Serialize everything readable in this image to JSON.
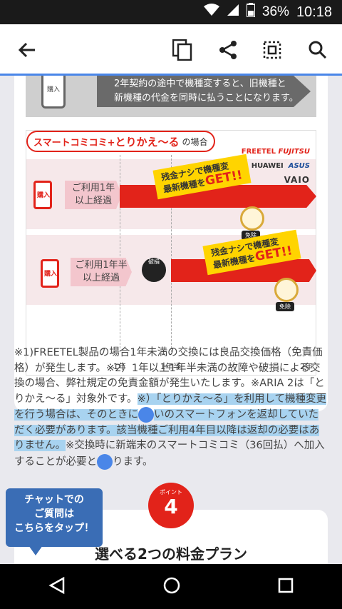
{
  "status_bar": {
    "battery": "36%",
    "time": "10:18"
  },
  "toolbar": {
    "back": "back",
    "copy": "copy",
    "share": "share",
    "select_all": "select-all",
    "search": "search"
  },
  "old_contract": {
    "phone_label": "購入",
    "text_line1": "2年契約の途中で機種変すると、旧機種と",
    "text_line2": "新機種の代金を同時に払うことになります。"
  },
  "diagram": {
    "title_a": "スマートコミコミ+",
    "title_b": "とりかえ〜る",
    "title_suffix": "の場合",
    "brands": [
      "FREETEL",
      "FUJITSU",
      "HUAWEI",
      "ASUS",
      "VAIO"
    ],
    "row1": {
      "phone_label": "購入",
      "text_line1": "ご利用1年",
      "text_line2": "以上経過",
      "tag_line1": "残金ナシで機種変",
      "tag_line2": "最新機種を",
      "tag_get": "GET!!",
      "exempt": "免除"
    },
    "row2": {
      "phone_label": "購入",
      "text_line1": "ご利用1年半",
      "text_line2": "以上経過",
      "tag_line1": "残金ナシで機種変",
      "tag_line2": "最新機種を",
      "tag_get": "GET!!",
      "exempt": "免除",
      "broken_label": "破損"
    },
    "axis": [
      "1年",
      "1年半",
      "2年"
    ]
  },
  "notes": {
    "p1": "※1)FREETEL製品の場合1年未満の交換には良品交換価格（免責価格）が発生します。※2）1年以上1年半未満の故障や破損による交換の場合、弊社規定の免責金額が発生いたします。※ARIA 2は「とりかえ〜る」対象外です。",
    "hl1": "※）「とりかえ〜る」を利用して機種変更を行う場合は、そのときに",
    "hl2": "いのスマートフォンを返却していただく必要があります。該当機種ご利用4年目以降は返却の必要はありません。",
    "p2a": "※交換時に新端末のスマートコミコミ（36回払）へ加入することが必要と",
    "p2b": "ります。"
  },
  "chat": {
    "line1": "チャットでの",
    "line2": "ご質問は",
    "line3": "こちらをタップ！"
  },
  "point": {
    "label": "ポイント",
    "number": "4"
  },
  "plan_title": "選べる2つの料金プラン",
  "colors": {
    "accent": "#e2231a",
    "highlight": "#a8d3f0",
    "handle": "#4a86e8",
    "chat": "#3a6db5"
  }
}
